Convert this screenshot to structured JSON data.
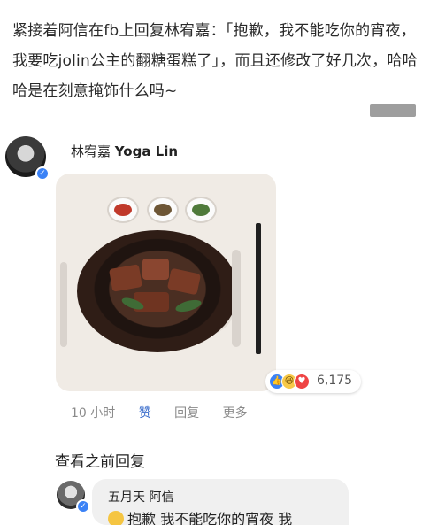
{
  "intro": {
    "text": "紧接着阿信在fb上回复林宥嘉：「抱歉，我不能吃你的宵夜，我要吃jolin公主的翻糖蛋糕了」，而且还修改了好几次，哈哈哈是在刻意掩饰什么吗~"
  },
  "post": {
    "author_cn": "林宥嘉",
    "author_en": "Yoga Lin",
    "reaction_count": "6,175",
    "time": "10 小时",
    "like_label": "赞",
    "reply_label": "回复",
    "more_label": "更多"
  },
  "replies": {
    "see_previous": "查看之前回复",
    "reply_author": "五月天 阿信",
    "reply_text": "抱歉 我不能吃你的宵夜 我"
  },
  "colors": {
    "verified": "#3b82f6",
    "like_action": "#3b6ecc"
  },
  "icons": {
    "verified": "verified-badge-icon",
    "like": "like-reaction-icon",
    "haha": "haha-reaction-icon",
    "love": "love-reaction-icon",
    "emoji": "flushed-face-emoji-icon"
  }
}
